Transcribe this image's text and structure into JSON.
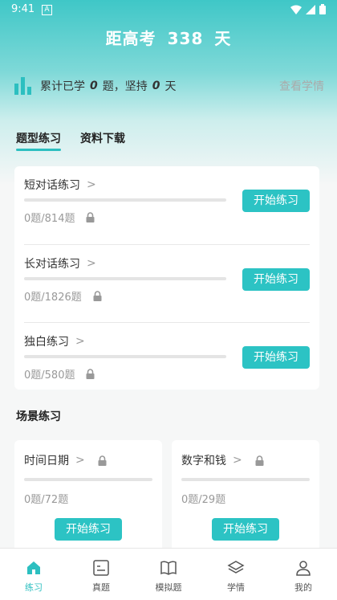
{
  "status": {
    "time": "9:41",
    "a_badge": "A"
  },
  "header": {
    "prefix": "距高考",
    "days": "338",
    "suffix": "天"
  },
  "stats": {
    "learned_prefix": "累计已学",
    "learned_count": "0",
    "learned_unit": "题，坚持",
    "streak_count": "0",
    "streak_unit": "天",
    "view_link": "查看学情"
  },
  "tabs": [
    {
      "label": "题型练习",
      "active": true
    },
    {
      "label": "资料下载",
      "active": false
    }
  ],
  "practice": [
    {
      "title": "短对话练习",
      "count": "0题/814题",
      "button": "开始练习",
      "progress": 0
    },
    {
      "title": "长对话练习",
      "count": "0题/1826题",
      "button": "开始练习",
      "progress": 0
    },
    {
      "title": "独白练习",
      "count": "0题/580题",
      "button": "开始练习",
      "progress": 0
    }
  ],
  "scene_section": {
    "title": "场景练习"
  },
  "scenes": [
    {
      "title": "时间日期",
      "count": "0题/72题",
      "button": "开始练习",
      "progress": 0
    },
    {
      "title": "数字和钱",
      "count": "0题/29题",
      "button": "开始练习",
      "progress": 0
    }
  ],
  "bottom_nav": [
    {
      "label": "练习",
      "icon": "home-icon",
      "active": true
    },
    {
      "label": "真题",
      "icon": "exam-paper-icon",
      "active": false
    },
    {
      "label": "模拟题",
      "icon": "book-icon",
      "active": false
    },
    {
      "label": "学情",
      "icon": "layers-icon",
      "active": false
    },
    {
      "label": "我的",
      "icon": "user-icon",
      "active": false
    }
  ],
  "colors": {
    "accent": "#2cc3c4",
    "header_bg": "#3fc7c7"
  }
}
